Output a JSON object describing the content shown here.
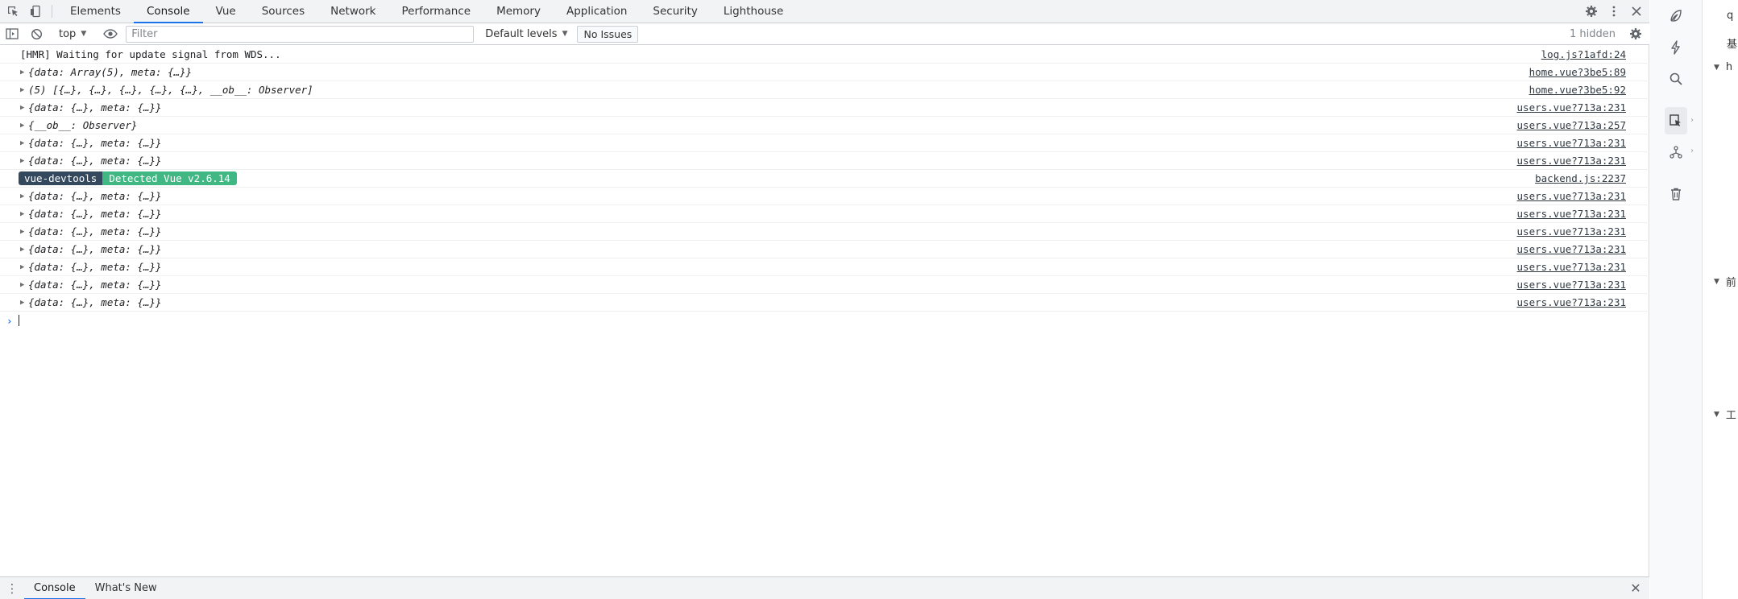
{
  "tabs": {
    "items": [
      "Elements",
      "Console",
      "Vue",
      "Sources",
      "Network",
      "Performance",
      "Memory",
      "Application",
      "Security",
      "Lighthouse"
    ],
    "active": "Console"
  },
  "toolbar": {
    "context": "top",
    "filter_placeholder": "Filter",
    "levels": "Default levels",
    "issues": "No Issues",
    "hidden": "1 hidden"
  },
  "console": {
    "rows": [
      {
        "kind": "plain",
        "text": "[HMR] Waiting for update signal from WDS...",
        "source": "log.js?1afd:24"
      },
      {
        "kind": "object",
        "text": "{data: Array(5), meta: {…}}",
        "source": "home.vue?3be5:89"
      },
      {
        "kind": "object",
        "text": "(5) [{…}, {…}, {…}, {…}, {…}, __ob__: Observer]",
        "source": "home.vue?3be5:92"
      },
      {
        "kind": "object",
        "text": "{data: {…}, meta: {…}}",
        "source": "users.vue?713a:231"
      },
      {
        "kind": "object",
        "text": "{__ob__: Observer}",
        "source": "users.vue?713a:257"
      },
      {
        "kind": "object",
        "text": "{data: {…}, meta: {…}}",
        "source": "users.vue?713a:231"
      },
      {
        "kind": "object",
        "text": "{data: {…}, meta: {…}}",
        "source": "users.vue?713a:231"
      },
      {
        "kind": "badge",
        "badge_left": "vue-devtools",
        "badge_right": "Detected Vue v2.6.14",
        "source": "backend.js:2237"
      },
      {
        "kind": "object",
        "text": "{data: {…}, meta: {…}}",
        "source": "users.vue?713a:231"
      },
      {
        "kind": "object",
        "text": "{data: {…}, meta: {…}}",
        "source": "users.vue?713a:231"
      },
      {
        "kind": "object",
        "text": "{data: {…}, meta: {…}}",
        "source": "users.vue?713a:231"
      },
      {
        "kind": "object",
        "text": "{data: {…}, meta: {…}}",
        "source": "users.vue?713a:231"
      },
      {
        "kind": "object",
        "text": "{data: {…}, meta: {…}}",
        "source": "users.vue?713a:231"
      },
      {
        "kind": "object",
        "text": "{data: {…}, meta: {…}}",
        "source": "users.vue?713a:231"
      },
      {
        "kind": "object",
        "text": "{data: {…}, meta: {…}}",
        "source": "users.vue?713a:231"
      }
    ],
    "prompt": "›"
  },
  "drawer": {
    "tabs": [
      "Console",
      "What's New"
    ],
    "active": "Console"
  },
  "page_strip": {
    "items": [
      "q",
      "基",
      "h",
      "前",
      "工"
    ]
  },
  "colors": {
    "accent": "#1a73e8",
    "vue_dark": "#35495e",
    "vue_green": "#41b883"
  }
}
